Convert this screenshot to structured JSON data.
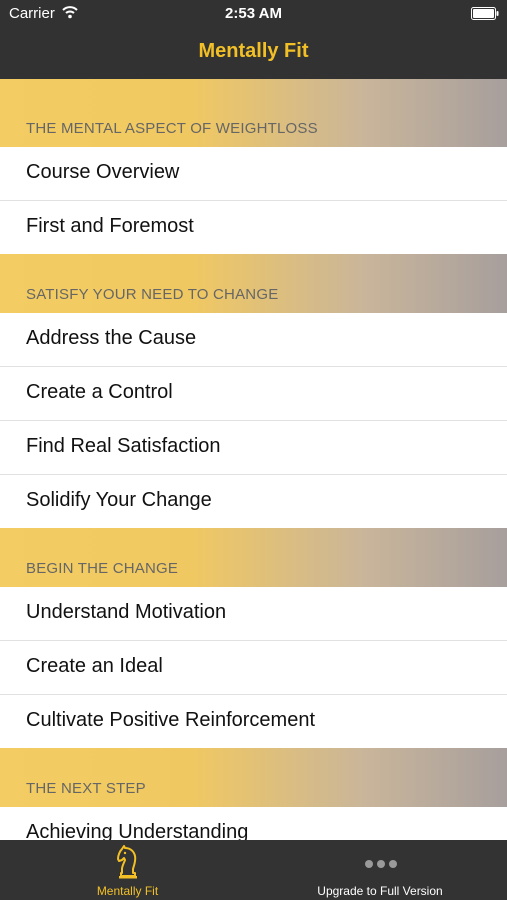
{
  "status_bar": {
    "carrier": "Carrier",
    "time": "2:53 AM"
  },
  "nav": {
    "title": "Mentally Fit"
  },
  "sections": [
    {
      "header": "THE MENTAL ASPECT OF WEIGHTLOSS",
      "items": [
        "Course Overview",
        "First and Foremost"
      ]
    },
    {
      "header": "SATISFY YOUR NEED TO CHANGE",
      "items": [
        "Address the Cause",
        "Create a Control",
        "Find Real Satisfaction",
        "Solidify Your Change"
      ]
    },
    {
      "header": "BEGIN THE CHANGE",
      "items": [
        "Understand Motivation",
        "Create an Ideal",
        "Cultivate Positive Reinforcement"
      ]
    },
    {
      "header": "THE NEXT STEP",
      "items": [
        "Achieving Understanding"
      ]
    }
  ],
  "tab_bar": {
    "tabs": [
      {
        "label": "Mentally Fit",
        "icon": "knight-chess-icon",
        "selected": true
      },
      {
        "label": "Upgrade to Full Version",
        "icon": "more-dots-icon",
        "selected": false
      }
    ]
  },
  "colors": {
    "accent": "#f2c026",
    "bar_background": "#323232",
    "header_gradient_start": "#f3cd63",
    "header_gradient_end": "#a79f9d"
  }
}
